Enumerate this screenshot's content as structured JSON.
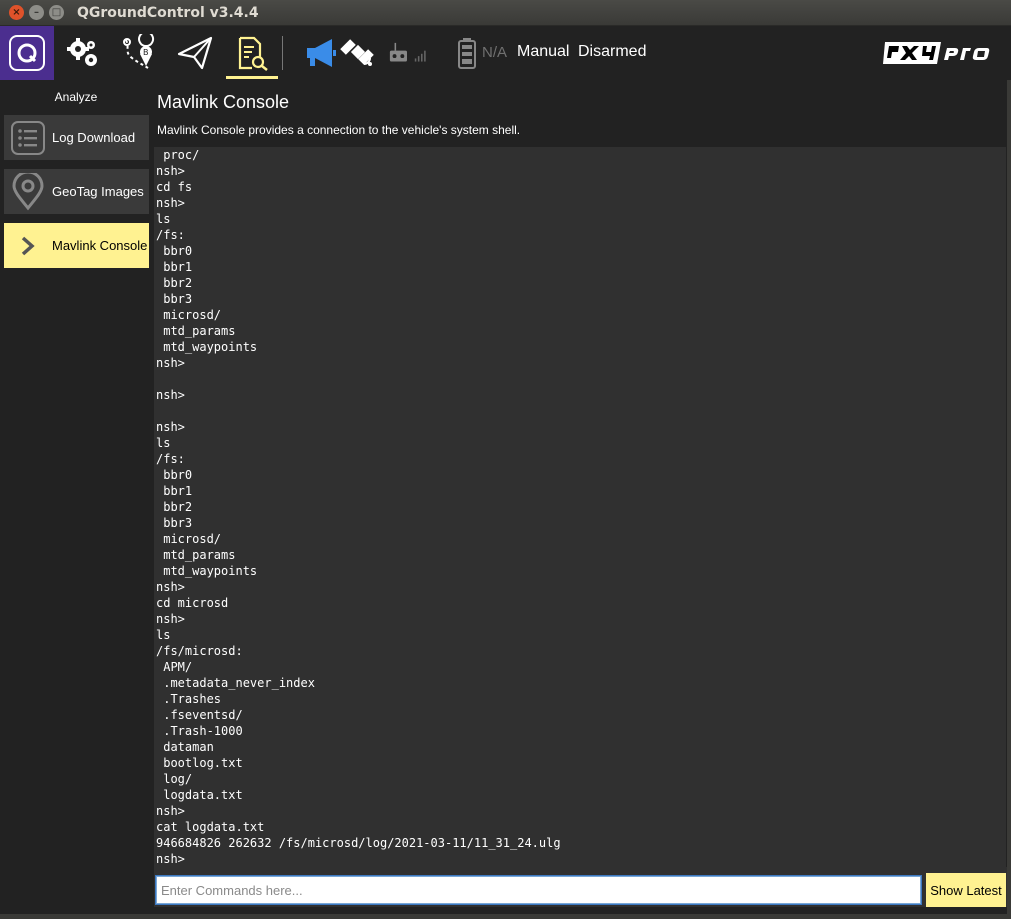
{
  "window": {
    "title": "QGroundControl v3.4.4",
    "close_glyph": "×",
    "minimize_glyph": "–",
    "maximize_glyph": "□"
  },
  "toolbar": {
    "icons": [
      "qgc-logo-icon",
      "settings-gears-icon",
      "plan-route-icon",
      "fly-paper-plane-icon",
      "analyze-document-icon",
      "messages-megaphone-icon",
      "gps-satellite-icon",
      "rc-transmitter-icon",
      "battery-icon"
    ],
    "battery_text": "N/A",
    "flight_mode": "Manual",
    "arm_state": "Disarmed",
    "brand_logo": "px4-autopilot-pro-logo",
    "colors": {
      "accent": "#fff291",
      "logo_bg": "#4b2e8f",
      "megaphone": "#3a8ce8"
    }
  },
  "sidebar": {
    "title": "Analyze",
    "items": [
      {
        "label": "Log Download",
        "icon": "list-icon",
        "active": false
      },
      {
        "label": "GeoTag Images",
        "icon": "map-pin-icon",
        "active": false
      },
      {
        "label": "Mavlink Console",
        "icon": "chevron-right-icon",
        "active": true
      }
    ]
  },
  "main": {
    "title": "Mavlink Console",
    "description": "Mavlink Console provides a connection to the vehicle's system shell.",
    "console_lines": [
      " proc/",
      "nsh>",
      "cd fs",
      "nsh>",
      "ls",
      "/fs:",
      " bbr0",
      " bbr1",
      " bbr2",
      " bbr3",
      " microsd/",
      " mtd_params",
      " mtd_waypoints",
      "nsh>",
      "",
      "nsh>",
      "",
      "nsh>",
      "ls",
      "/fs:",
      " bbr0",
      " bbr1",
      " bbr2",
      " bbr3",
      " microsd/",
      " mtd_params",
      " mtd_waypoints",
      "nsh>",
      "cd microsd",
      "nsh>",
      "ls",
      "/fs/microsd:",
      " APM/",
      " .metadata_never_index",
      " .Trashes",
      " .fseventsd/",
      " .Trash-1000",
      " dataman",
      " bootlog.txt",
      " log/",
      " logdata.txt",
      "nsh>",
      "cat logdata.txt",
      "946684826 262632 /fs/microsd/log/2021-03-11/11_31_24.ulg",
      "nsh>"
    ],
    "command_input": {
      "value": "",
      "placeholder": "Enter Commands here..."
    },
    "show_latest_label": "Show Latest"
  }
}
